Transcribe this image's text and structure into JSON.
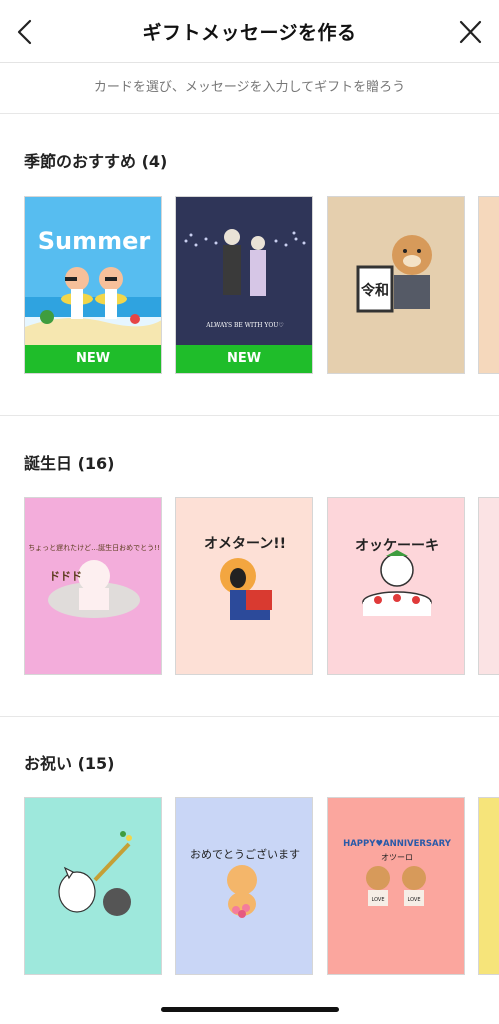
{
  "header": {
    "title": "ギフトメッセージを作る",
    "back_icon": "chevron-left-icon",
    "close_icon": "close-icon"
  },
  "subtitle": "カードを選び、メッセージを入力してギフトを贈ろう",
  "sections": [
    {
      "title": "季節のおすすめ (4)",
      "cards": [
        {
          "art_text": "Summer",
          "badge": "NEW"
        },
        {
          "art_text": "ALWAYS BE WITH YOU♡",
          "badge": "NEW"
        },
        {
          "art_text": "令和"
        }
      ]
    },
    {
      "title": "誕生日 (16)",
      "cards": [
        {
          "art_text": "ちょっと遅れたけど…誕生日おめでとう!!",
          "art_text_2": "ドドド"
        },
        {
          "art_text": "オメターン!!"
        },
        {
          "art_text": "オッケーーキ"
        }
      ]
    },
    {
      "title": "お祝い (15)",
      "cards": [
        {
          "art_text": ""
        },
        {
          "art_text": "おめでとうございます"
        },
        {
          "art_text": "HAPPY♥ANNIVERSARY",
          "art_text_2": "オツーロ",
          "art_text_3": "LOVE"
        }
      ]
    }
  ],
  "colors": {
    "new_badge": "#1fbd2a",
    "card1_bg": "#e6f6ff",
    "card2_bg": "#2f3558",
    "card3_bg": "#e5cfae",
    "bday1_bg": "#f3addb",
    "bday2_bg": "#fde0d6",
    "bday3_bg": "#fdd6da",
    "celeb1_bg": "#9ee8dc",
    "celeb2_bg": "#c9d6f6",
    "celeb3_bg": "#fba69e"
  }
}
